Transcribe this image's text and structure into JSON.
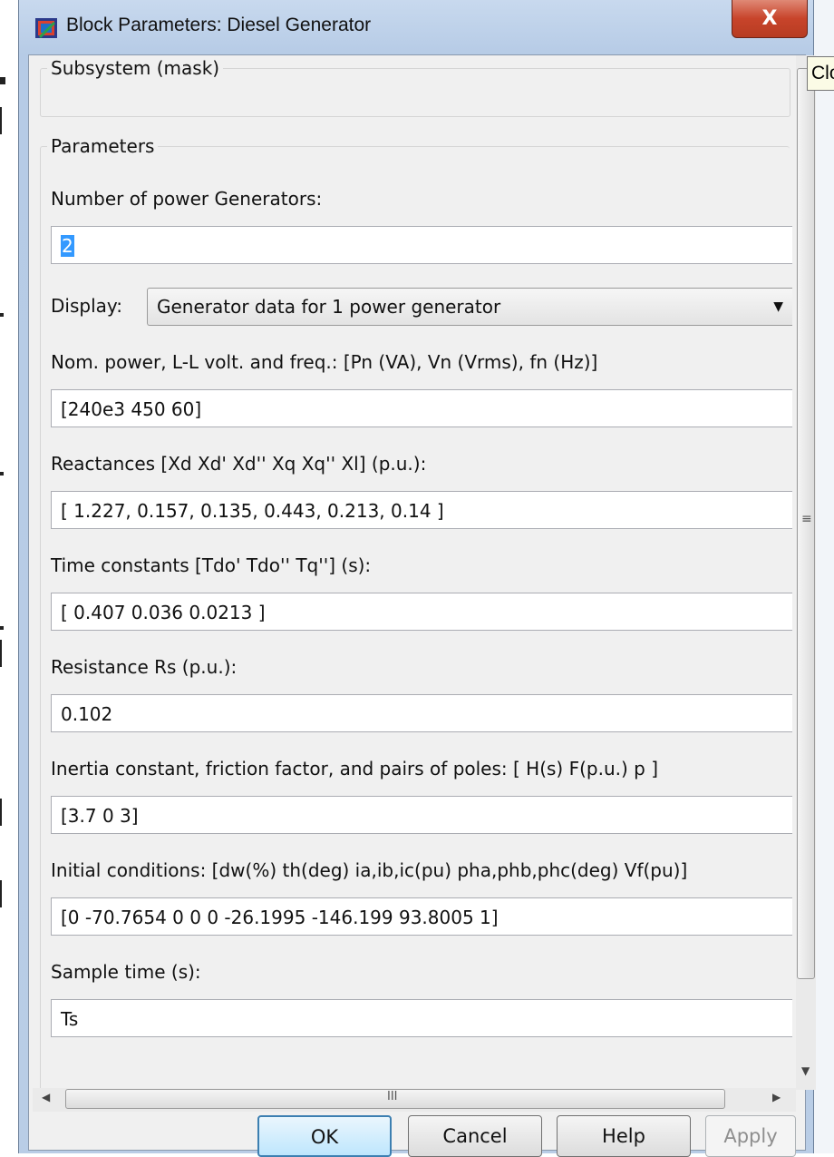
{
  "window": {
    "title": "Block Parameters: Diesel Generator",
    "close_glyph": "X",
    "tooltip": "Close"
  },
  "mask_group": {
    "label": "Subsystem (mask)"
  },
  "params_group": {
    "label": "Parameters"
  },
  "fields": {
    "num_generators": {
      "label": "Number of power Generators:",
      "value": "2"
    },
    "display": {
      "label": "Display:",
      "value": "Generator data for 1 power generator"
    },
    "nominal": {
      "label": "Nom. power, L-L volt. and freq.: [Pn (VA), Vn (Vrms), fn (Hz)]",
      "value": "[240e3 450 60]"
    },
    "reactances": {
      "label": "Reactances [Xd Xd' Xd'' Xq Xq'' Xl] (p.u.):",
      "value": "[ 1.227, 0.157, 0.135, 0.443,  0.213,  0.14 ]"
    },
    "time_constants": {
      "label": "Time constants [Tdo' Tdo'' Tq''] (s):",
      "value": "[  0.407  0.036  0.0213  ]"
    },
    "resistance": {
      "label": "Resistance Rs (p.u.):",
      "value": "0.102"
    },
    "inertia": {
      "label": "Inertia constant, friction factor, and pairs of poles: [ H(s)  F(p.u.)  p ]",
      "value": "[3.7 0 3]"
    },
    "initial_conditions": {
      "label": "Initial conditions: [dw(%) th(deg) ia,ib,ic(pu) pha,phb,phc(deg) Vf(pu)]",
      "value": "[0 -70.7654 0 0 0 -26.1995 -146.199 93.8005 1]"
    },
    "sample_time": {
      "label": "Sample time (s):",
      "value": "Ts"
    }
  },
  "scrollbars": {
    "h_grip": "III",
    "v_grip": "≡"
  },
  "buttons": {
    "ok": "OK",
    "cancel": "Cancel",
    "help": "Help",
    "apply": "Apply"
  }
}
